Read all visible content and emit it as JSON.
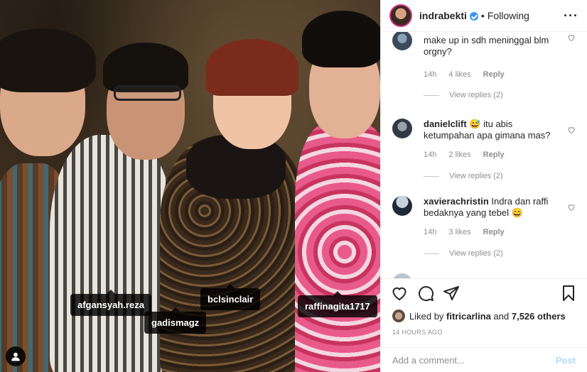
{
  "post": {
    "username": "indrabekti",
    "dot": "•",
    "follow_status": "Following",
    "more": "···"
  },
  "photo_tags": [
    {
      "label": "afgansyah.reza"
    },
    {
      "label": "gadismagz"
    },
    {
      "label": "bclsinclair"
    },
    {
      "label": "raffinagita1717"
    }
  ],
  "comments": [
    {
      "username": "",
      "text": "make up in sdh meninggal blm orgny?",
      "time": "14h",
      "likes": "4 likes",
      "reply": "Reply",
      "view_replies": "View replies (2)"
    },
    {
      "username": "danielclift",
      "text": "😅 itu abis ketumpahan apa gimana mas?",
      "time": "14h",
      "likes": "2 likes",
      "reply": "Reply",
      "view_replies": "View replies (2)"
    },
    {
      "username": "xavierachristin",
      "text": "Indra dan raffi bedaknya yang tebel 😄",
      "time": "14h",
      "likes": "3 likes",
      "reply": "Reply",
      "view_replies": "View replies (2)"
    }
  ],
  "likes": {
    "prefix": "Liked by",
    "user": "fitricarlina",
    "middle": "and",
    "others": "7,526 others"
  },
  "timestamp": "14 HOURS AGO",
  "add_comment": {
    "placeholder": "Add a comment...",
    "post_label": "Post"
  },
  "colors": {
    "verified": "#3897f0",
    "post_disabled": "#b3dbff",
    "muted": "#8e8e8e"
  }
}
